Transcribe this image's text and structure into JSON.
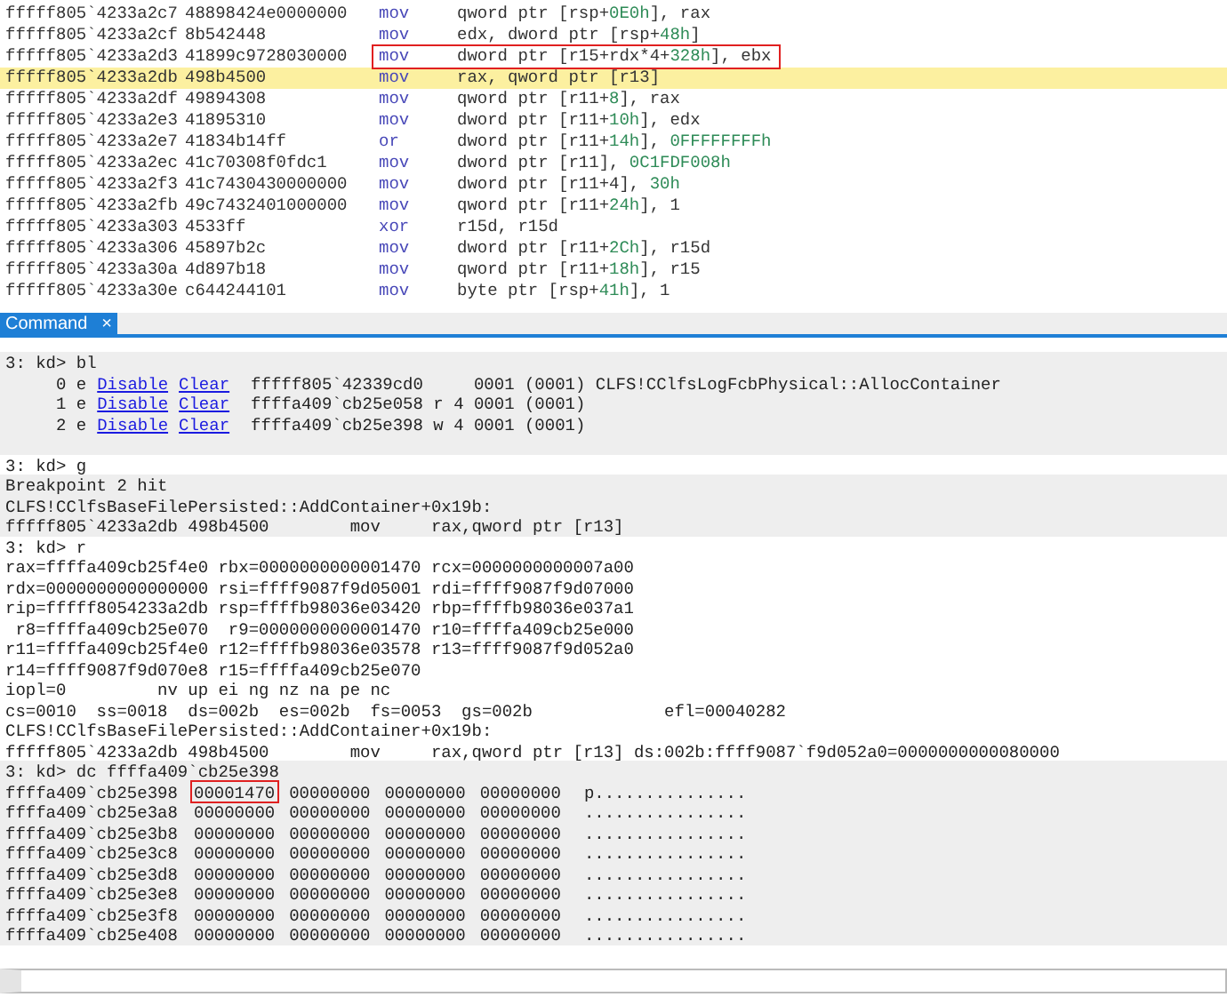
{
  "disassembly": {
    "rows": [
      {
        "address": "fffff805`4233a2c7",
        "bytes": "48898424e0000000",
        "mnemonic": "mov",
        "operands": [
          {
            "kind": "plain",
            "t": "qword ptr [rsp+"
          },
          {
            "kind": "number",
            "t": "0E0h"
          },
          {
            "kind": "plain",
            "t": "], rax"
          }
        ],
        "current": false,
        "boxed": false
      },
      {
        "address": "fffff805`4233a2cf",
        "bytes": "8b542448",
        "mnemonic": "mov",
        "operands": [
          {
            "kind": "plain",
            "t": "edx, dword ptr [rsp+"
          },
          {
            "kind": "number",
            "t": "48h"
          },
          {
            "kind": "plain",
            "t": "]"
          }
        ],
        "current": false,
        "boxed": false
      },
      {
        "address": "fffff805`4233a2d3",
        "bytes": "41899c9728030000",
        "mnemonic": "mov",
        "operands": [
          {
            "kind": "plain",
            "t": "dword ptr [r15+rdx*4+"
          },
          {
            "kind": "number",
            "t": "328h"
          },
          {
            "kind": "plain",
            "t": "], ebx"
          }
        ],
        "current": false,
        "boxed": true
      },
      {
        "address": "fffff805`4233a2db",
        "bytes": "498b4500",
        "mnemonic": "mov",
        "operands": [
          {
            "kind": "plain",
            "t": "rax, qword ptr [r13]"
          }
        ],
        "current": true,
        "boxed": false
      },
      {
        "address": "fffff805`4233a2df",
        "bytes": "49894308",
        "mnemonic": "mov",
        "operands": [
          {
            "kind": "plain",
            "t": "qword ptr [r11+"
          },
          {
            "kind": "number",
            "t": "8"
          },
          {
            "kind": "plain",
            "t": "], rax"
          }
        ],
        "current": false,
        "boxed": false
      },
      {
        "address": "fffff805`4233a2e3",
        "bytes": "41895310",
        "mnemonic": "mov",
        "operands": [
          {
            "kind": "plain",
            "t": "dword ptr [r11+"
          },
          {
            "kind": "number",
            "t": "10h"
          },
          {
            "kind": "plain",
            "t": "], edx"
          }
        ],
        "current": false,
        "boxed": false
      },
      {
        "address": "fffff805`4233a2e7",
        "bytes": "41834b14ff",
        "mnemonic": "or",
        "operands": [
          {
            "kind": "plain",
            "t": "dword ptr [r11+"
          },
          {
            "kind": "number",
            "t": "14h"
          },
          {
            "kind": "plain",
            "t": "], "
          },
          {
            "kind": "number",
            "t": "0FFFFFFFFh"
          }
        ],
        "current": false,
        "boxed": false
      },
      {
        "address": "fffff805`4233a2ec",
        "bytes": "41c70308f0fdc1",
        "mnemonic": "mov",
        "operands": [
          {
            "kind": "plain",
            "t": "dword ptr [r11], "
          },
          {
            "kind": "number",
            "t": "0C1FDF008h"
          }
        ],
        "current": false,
        "boxed": false
      },
      {
        "address": "fffff805`4233a2f3",
        "bytes": "41c7430430000000",
        "mnemonic": "mov",
        "operands": [
          {
            "kind": "plain",
            "t": "dword ptr [r11+4], "
          },
          {
            "kind": "number",
            "t": "30h"
          }
        ],
        "current": false,
        "boxed": false
      },
      {
        "address": "fffff805`4233a2fb",
        "bytes": "49c7432401000000",
        "mnemonic": "mov",
        "operands": [
          {
            "kind": "plain",
            "t": "qword ptr [r11+"
          },
          {
            "kind": "number",
            "t": "24h"
          },
          {
            "kind": "plain",
            "t": "], 1"
          }
        ],
        "current": false,
        "boxed": false
      },
      {
        "address": "fffff805`4233a303",
        "bytes": "4533ff",
        "mnemonic": "xor",
        "operands": [
          {
            "kind": "plain",
            "t": "r15d, r15d"
          }
        ],
        "current": false,
        "boxed": false
      },
      {
        "address": "fffff805`4233a306",
        "bytes": "45897b2c",
        "mnemonic": "mov",
        "operands": [
          {
            "kind": "plain",
            "t": "dword ptr [r11+"
          },
          {
            "kind": "number",
            "t": "2Ch"
          },
          {
            "kind": "plain",
            "t": "], r15d"
          }
        ],
        "current": false,
        "boxed": false
      },
      {
        "address": "fffff805`4233a30a",
        "bytes": "4d897b18",
        "mnemonic": "mov",
        "operands": [
          {
            "kind": "plain",
            "t": "qword ptr [r11+"
          },
          {
            "kind": "number",
            "t": "18h"
          },
          {
            "kind": "plain",
            "t": "], r15"
          }
        ],
        "current": false,
        "boxed": false
      },
      {
        "address": "fffff805`4233a30e",
        "bytes": "c644244101",
        "mnemonic": "mov",
        "operands": [
          {
            "kind": "plain",
            "t": "byte ptr [rsp+"
          },
          {
            "kind": "number",
            "t": "41h"
          },
          {
            "kind": "plain",
            "t": "], 1"
          }
        ],
        "current": false,
        "boxed": false
      }
    ]
  },
  "tabs": [
    {
      "label": "Command",
      "selected": true,
      "close": "×"
    }
  ],
  "command": {
    "blocks": [
      {
        "shaded": true,
        "lines": [
          {
            "kind": "text",
            "text": "3: kd> bl"
          },
          {
            "kind": "breakpoint",
            "prefix": "     0 e",
            "links": [
              "Disable",
              "Clear"
            ],
            "rest": "fffff805`42339cd0     0001 (0001) CLFS!CClfsLogFcbPhysical::AllocContainer"
          },
          {
            "kind": "breakpoint",
            "prefix": "     1 e",
            "links": [
              "Disable",
              "Clear"
            ],
            "rest": "ffffa409`cb25e058 r 4 0001 (0001)"
          },
          {
            "kind": "breakpoint",
            "prefix": "     2 e",
            "links": [
              "Disable",
              "Clear"
            ],
            "rest": "ffffa409`cb25e398 w 4 0001 (0001)"
          },
          {
            "kind": "blank"
          }
        ]
      },
      {
        "shaded": false,
        "lines": [
          {
            "kind": "text",
            "text": "3: kd> g"
          }
        ]
      },
      {
        "shaded": true,
        "lines": [
          {
            "kind": "text",
            "text": "Breakpoint 2 hit"
          },
          {
            "kind": "text",
            "text": "CLFS!CClfsBaseFilePersisted::AddContainer+0x19b:"
          },
          {
            "kind": "text",
            "text": "fffff805`4233a2db 498b4500        mov     rax,qword ptr [r13]"
          }
        ]
      },
      {
        "shaded": false,
        "lines": [
          {
            "kind": "text",
            "text": "3: kd> r"
          },
          {
            "kind": "text",
            "text": "rax=ffffa409cb25f4e0 rbx=0000000000001470 rcx=0000000000007a00"
          },
          {
            "kind": "text",
            "text": "rdx=0000000000000000 rsi=ffff9087f9d05001 rdi=ffff9087f9d07000"
          },
          {
            "kind": "text",
            "text": "rip=fffff8054233a2db rsp=ffffb98036e03420 rbp=ffffb98036e037a1"
          },
          {
            "kind": "text",
            "text": " r8=ffffa409cb25e070  r9=0000000000001470 r10=ffffa409cb25e000"
          },
          {
            "kind": "text",
            "text": "r11=ffffa409cb25f4e0 r12=ffffb98036e03578 r13=ffff9087f9d052a0"
          },
          {
            "kind": "text",
            "text": "r14=ffff9087f9d070e8 r15=ffffa409cb25e070"
          },
          {
            "kind": "text",
            "text": "iopl=0         nv up ei ng nz na pe nc"
          },
          {
            "kind": "text",
            "text": "cs=0010  ss=0018  ds=002b  es=002b  fs=0053  gs=002b             efl=00040282"
          },
          {
            "kind": "text",
            "text": "CLFS!CClfsBaseFilePersisted::AddContainer+0x19b:"
          },
          {
            "kind": "text",
            "text": "fffff805`4233a2db 498b4500        mov     rax,qword ptr [r13] ds:002b:ffff9087`f9d052a0=0000000000080000"
          }
        ]
      },
      {
        "shaded": true,
        "lines": [
          {
            "kind": "text",
            "text": "3: kd> dc ffffa409`cb25e398"
          },
          {
            "kind": "memory",
            "address": "ffffa409`cb25e398",
            "words": [
              {
                "t": "00001470",
                "boxed": true
              },
              {
                "t": "00000000",
                "boxed": false
              },
              {
                "t": "00000000",
                "boxed": false
              },
              {
                "t": "00000000",
                "boxed": false
              }
            ],
            "ascii": "p..............."
          },
          {
            "kind": "memory",
            "address": "ffffa409`cb25e3a8",
            "words": [
              {
                "t": "00000000",
                "boxed": false
              },
              {
                "t": "00000000",
                "boxed": false
              },
              {
                "t": "00000000",
                "boxed": false
              },
              {
                "t": "00000000",
                "boxed": false
              }
            ],
            "ascii": "................"
          },
          {
            "kind": "memory",
            "address": "ffffa409`cb25e3b8",
            "words": [
              {
                "t": "00000000",
                "boxed": false
              },
              {
                "t": "00000000",
                "boxed": false
              },
              {
                "t": "00000000",
                "boxed": false
              },
              {
                "t": "00000000",
                "boxed": false
              }
            ],
            "ascii": "................"
          },
          {
            "kind": "memory",
            "address": "ffffa409`cb25e3c8",
            "words": [
              {
                "t": "00000000",
                "boxed": false
              },
              {
                "t": "00000000",
                "boxed": false
              },
              {
                "t": "00000000",
                "boxed": false
              },
              {
                "t": "00000000",
                "boxed": false
              }
            ],
            "ascii": "................"
          },
          {
            "kind": "memory",
            "address": "ffffa409`cb25e3d8",
            "words": [
              {
                "t": "00000000",
                "boxed": false
              },
              {
                "t": "00000000",
                "boxed": false
              },
              {
                "t": "00000000",
                "boxed": false
              },
              {
                "t": "00000000",
                "boxed": false
              }
            ],
            "ascii": "................"
          },
          {
            "kind": "memory",
            "address": "ffffa409`cb25e3e8",
            "words": [
              {
                "t": "00000000",
                "boxed": false
              },
              {
                "t": "00000000",
                "boxed": false
              },
              {
                "t": "00000000",
                "boxed": false
              },
              {
                "t": "00000000",
                "boxed": false
              }
            ],
            "ascii": "................"
          },
          {
            "kind": "memory",
            "address": "ffffa409`cb25e3f8",
            "words": [
              {
                "t": "00000000",
                "boxed": false
              },
              {
                "t": "00000000",
                "boxed": false
              },
              {
                "t": "00000000",
                "boxed": false
              },
              {
                "t": "00000000",
                "boxed": false
              }
            ],
            "ascii": "................"
          },
          {
            "kind": "memory",
            "address": "ffffa409`cb25e408",
            "words": [
              {
                "t": "00000000",
                "boxed": false
              },
              {
                "t": "00000000",
                "boxed": false
              },
              {
                "t": "00000000",
                "boxed": false
              },
              {
                "t": "00000000",
                "boxed": false
              }
            ],
            "ascii": "................"
          }
        ]
      }
    ]
  }
}
